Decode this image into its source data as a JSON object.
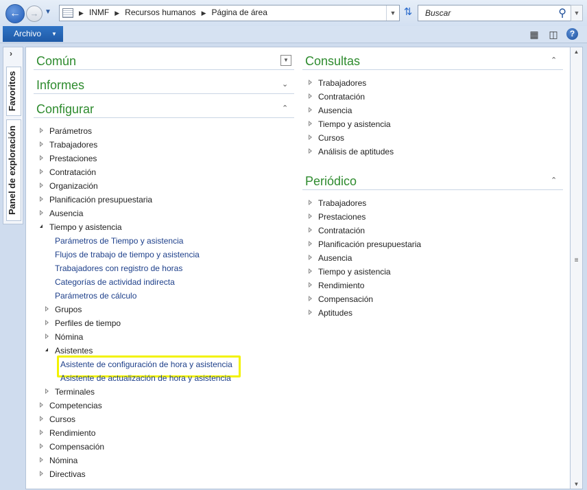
{
  "address": {
    "crumbs": [
      "INMF",
      "Recursos humanos",
      "Página de área"
    ]
  },
  "search": {
    "placeholder": "Buscar"
  },
  "menu": {
    "archivo": "Archivo"
  },
  "sidepane": {
    "favoritos": "Favoritos",
    "panel": "Panel de exploración"
  },
  "sections": {
    "comun": "Común",
    "informes": "Informes",
    "configurar": "Configurar",
    "consultas": "Consultas",
    "periodico": "Periódico"
  },
  "configurar_items": {
    "parametros": "Parámetros",
    "trabajadores": "Trabajadores",
    "prestaciones": "Prestaciones",
    "contratacion": "Contratación",
    "organizacion": "Organización",
    "planificacion": "Planificación presupuestaria",
    "ausencia": "Ausencia",
    "tiempo": "Tiempo y asistencia",
    "t_parametros": "Parámetros de Tiempo y asistencia",
    "t_flujos": "Flujos de trabajo de tiempo y asistencia",
    "t_trabajadores": "Trabajadores con registro de horas",
    "t_categorias": "Categorías de actividad indirecta",
    "t_calculo": "Parámetros de cálculo",
    "t_grupos": "Grupos",
    "t_perfiles": "Perfiles de tiempo",
    "t_nomina": "Nómina",
    "t_asistentes": "Asistentes",
    "a_config": "Asistente de configuración de hora y asistencia",
    "a_actual": "Asistente de actualización de hora y asistencia",
    "t_terminales": "Terminales",
    "competencias": "Competencias",
    "cursos": "Cursos",
    "rendimiento": "Rendimiento",
    "compensacion": "Compensación",
    "nomina": "Nómina",
    "directivas": "Directivas"
  },
  "consultas_items": {
    "trabajadores": "Trabajadores",
    "contratacion": "Contratación",
    "ausencia": "Ausencia",
    "tiempo": "Tiempo y asistencia",
    "cursos": "Cursos",
    "aptitudes": "Análisis de aptitudes"
  },
  "periodico_items": {
    "trabajadores": "Trabajadores",
    "prestaciones": "Prestaciones",
    "contratacion": "Contratación",
    "planificacion": "Planificación presupuestaria",
    "ausencia": "Ausencia",
    "tiempo": "Tiempo y asistencia",
    "rendimiento": "Rendimiento",
    "compensacion": "Compensación",
    "aptitudes": "Aptitudes"
  },
  "colors": {
    "section_heading": "#2e8b2e",
    "link": "#1d3f8a",
    "highlight": "#f2f200",
    "archivo": "#1f5aa7"
  }
}
